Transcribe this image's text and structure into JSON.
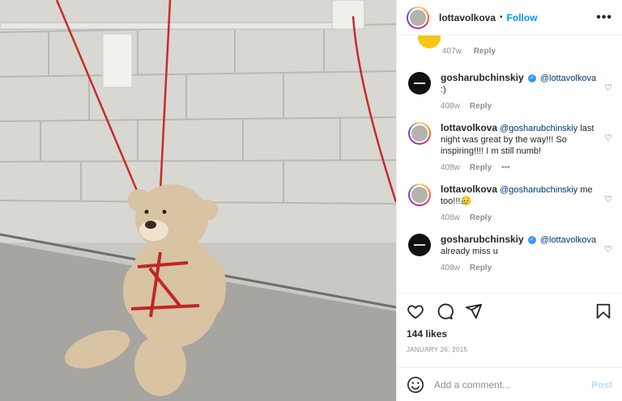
{
  "post": {
    "username": "lottavolkova",
    "follow_label": "Follow",
    "likes": "144 likes",
    "date": "JANUARY 26, 2015",
    "comment_placeholder": "Add a comment...",
    "post_label": "Post"
  },
  "first_comment": {
    "age": "407w",
    "reply": "Reply"
  },
  "comments": [
    {
      "user": "gosharubchinskiy",
      "verified": true,
      "mention": "@lottavolkova",
      "text": ":)",
      "age": "408w",
      "reply": "Reply",
      "avatar": "black"
    },
    {
      "user": "lottavolkova",
      "verified": false,
      "mention": "@gosharubchinskiy",
      "text": "last night was great by the way!!! So inspiring!!!! I m still numb!",
      "age": "408w",
      "reply": "Reply",
      "avatar": "ring"
    },
    {
      "user": "lottavolkova",
      "verified": false,
      "mention": "@gosharubchinskiy",
      "text": "me too!!!😥",
      "age": "408w",
      "reply": "Reply",
      "avatar": "ring"
    },
    {
      "user": "gosharubchinskiy",
      "verified": true,
      "mention": "@lottavolkova",
      "text": "already miss u",
      "age": "408w",
      "reply": "Reply",
      "avatar": "black"
    }
  ],
  "icons": {
    "more": "more-options-icon",
    "like": "heart-icon",
    "comment": "comment-icon",
    "share": "share-icon",
    "save": "bookmark-icon",
    "emoji": "emoji-icon"
  }
}
